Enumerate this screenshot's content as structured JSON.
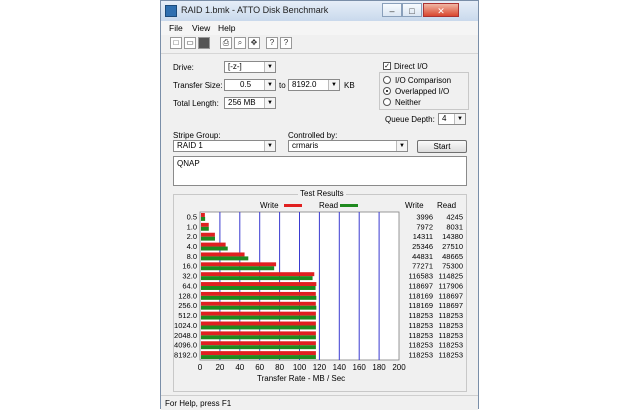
{
  "window": {
    "title": "RAID 1.bmk - ATTO Disk Benchmark",
    "min": "–",
    "max": "□",
    "close": "✕"
  },
  "menu": [
    "File",
    "View",
    "Help"
  ],
  "toolbar": [
    "new-icon",
    "open-icon",
    "save-icon",
    "print-icon",
    "print-preview-icon",
    "move-icon",
    "help-icon",
    "context-help-icon"
  ],
  "form": {
    "drive_label": "Drive:",
    "drive_value": "[-z-]",
    "transfer_label": "Transfer Size:",
    "transfer_from": "0.5",
    "to_label": "to",
    "transfer_to": "8192.0",
    "kb_label": "KB",
    "total_label": "Total Length:",
    "total_value": "256 MB",
    "direct_io": "Direct I/O",
    "io_comparison": "I/O Comparison",
    "overlapped_io": "Overlapped I/O",
    "neither": "Neither",
    "queue_label": "Queue Depth:",
    "queue_value": "4",
    "stripe_label": "Stripe Group:",
    "stripe_value": "RAID 1",
    "controlled_label": "Controlled by:",
    "controlled_value": "crmaris",
    "start_label": "Start",
    "description": "QNAP"
  },
  "results": {
    "title": "Test Results",
    "write_label": "Write",
    "read_label": "Read",
    "write_col": "Write",
    "read_col": "Read",
    "xlabel": "Transfer Rate - MB / Sec",
    "write_color": "#e02020",
    "read_color": "#1f8a1f"
  },
  "chart_data": {
    "type": "bar",
    "categories": [
      "0.5",
      "1.0",
      "2.0",
      "4.0",
      "8.0",
      "16.0",
      "32.0",
      "64.0",
      "128.0",
      "256.0",
      "512.0",
      "1024.0",
      "2048.0",
      "4096.0",
      "8192.0"
    ],
    "series": [
      {
        "name": "Write",
        "values": [
          3996,
          7972,
          14311,
          25346,
          44831,
          77271,
          116583,
          118697,
          118169,
          118169,
          118253,
          118253,
          118253,
          118253,
          118253
        ]
      },
      {
        "name": "Read",
        "values": [
          4245,
          8031,
          14380,
          27510,
          48665,
          75300,
          114825,
          117906,
          118697,
          118697,
          118253,
          118253,
          118253,
          118253,
          118253
        ]
      }
    ],
    "xticks": [
      0,
      20,
      40,
      60,
      80,
      100,
      120,
      140,
      160,
      180,
      200
    ],
    "xlim": [
      0,
      200
    ],
    "xlabel": "Transfer Rate - MB / Sec"
  },
  "status": "For Help, press F1"
}
